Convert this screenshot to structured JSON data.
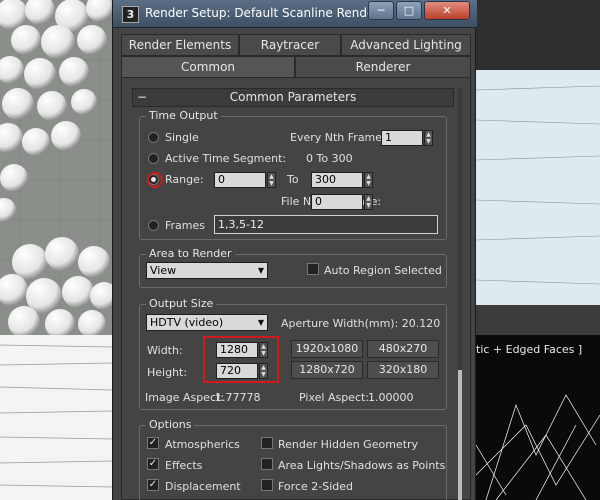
{
  "window": {
    "title": "Render Setup: Default Scanline Renderer",
    "icon_text": "3",
    "minimize_glyph": "─",
    "maximize_glyph": "□",
    "close_glyph": "✕"
  },
  "tabs": {
    "row1": [
      "Render Elements",
      "Raytracer",
      "Advanced Lighting"
    ],
    "row2": [
      "Common",
      "Renderer"
    ],
    "active": "Common"
  },
  "rollout": {
    "title": "Common Parameters",
    "toggle": "−"
  },
  "time_output": {
    "label": "Time Output",
    "single_label": "Single",
    "every_nth_label": "Every Nth Frame:",
    "every_nth_value": "1",
    "active_segment_label": "Active Time Segment:",
    "active_segment_value": "0 To 300",
    "range_label": "Range:",
    "range_start": "0",
    "range_to_label": "To",
    "range_end": "300",
    "file_number_base_label": "File Number Base:",
    "file_number_base_value": "0",
    "frames_label": "Frames",
    "frames_value": "1,3,5-12",
    "selected": "Range"
  },
  "area_to_render": {
    "label": "Area to Render",
    "selected": "View",
    "auto_region_label": "Auto Region Selected",
    "auto_region_checked": false
  },
  "output_size": {
    "label": "Output Size",
    "preset": "HDTV (video)",
    "aperture_label": "Aperture Width(mm): 20.120",
    "width_label": "Width:",
    "width_value": "1280",
    "height_label": "Height:",
    "height_value": "720",
    "preset_buttons": [
      "1920x1080",
      "480x270",
      "1280x720",
      "320x180"
    ],
    "image_aspect_label": "Image Aspect:",
    "image_aspect_value": "1.77778",
    "pixel_aspect_label": "Pixel Aspect:",
    "pixel_aspect_value": "1.00000"
  },
  "options": {
    "label": "Options",
    "items": [
      {
        "label": "Atmospherics",
        "checked": true
      },
      {
        "label": "Render Hidden Geometry",
        "checked": false
      },
      {
        "label": "Effects",
        "checked": true
      },
      {
        "label": "Area Lights/Shadows as Points",
        "checked": false
      },
      {
        "label": "Displacement",
        "checked": true
      },
      {
        "label": "Force 2-Sided",
        "checked": false
      }
    ]
  },
  "viewport": {
    "caption": "tic + Edged Faces ]"
  },
  "colors": {
    "dialog_bg": "#444444",
    "title_gradient_top": "#5b6f86",
    "highlight": "#d11a1a"
  }
}
